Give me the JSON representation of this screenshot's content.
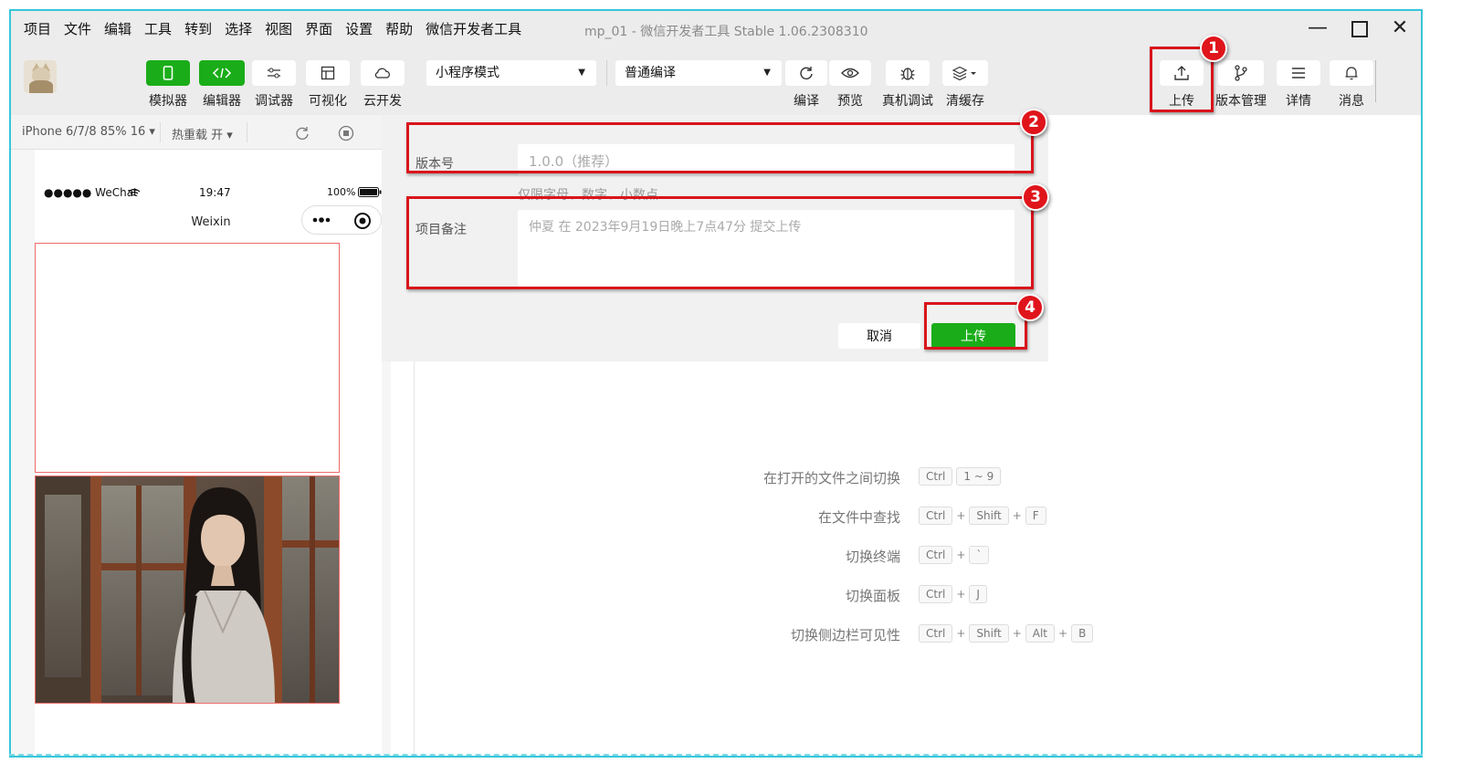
{
  "menu": [
    "项目",
    "文件",
    "编辑",
    "工具",
    "转到",
    "选择",
    "视图",
    "界面",
    "设置",
    "帮助",
    "微信开发者工具"
  ],
  "window": {
    "title": "mp_01 - 微信开发者工具 Stable 1.06.2308310"
  },
  "toolbar": {
    "simulator": "模拟器",
    "editor": "编辑器",
    "debugger": "调试器",
    "visual": "可视化",
    "cloud": "云开发",
    "mode_select": "小程序模式",
    "compile_select": "普通编译",
    "compile": "编译",
    "preview": "预览",
    "real_debug": "真机调试",
    "clear_cache": "清缓存",
    "upload": "上传",
    "version_mgmt": "版本管理",
    "details": "详情",
    "messages": "消息"
  },
  "simulator": {
    "device": "iPhone 6/7/8 85% 16 ▾",
    "hot_reload": "热重载 开 ▾",
    "carrier": "●●●●● WeChat",
    "time": "19:47",
    "battery": "100%",
    "nav_title": "Weixin"
  },
  "dialog": {
    "version_label": "版本号",
    "version_placeholder": "1.0.0（推荐）",
    "version_hint": "仅限字母、数字、小数点",
    "note_label": "项目备注",
    "note_placeholder": "仲夏  在  2023年9月19日晚上7点47分  提交上传",
    "cancel": "取消",
    "upload": "上传"
  },
  "annotations": [
    "1",
    "2",
    "3",
    "4"
  ],
  "shortcuts": [
    {
      "label": "在打开的文件之间切换",
      "keys": [
        "Ctrl",
        "1 ~ 9"
      ],
      "joined": false
    },
    {
      "label": "在文件中查找",
      "keys": [
        "Ctrl",
        "Shift",
        "F"
      ],
      "joined": true
    },
    {
      "label": "切换终端",
      "keys": [
        "Ctrl",
        "`"
      ],
      "joined": true
    },
    {
      "label": "切换面板",
      "keys": [
        "Ctrl",
        "J"
      ],
      "joined": true
    },
    {
      "label": "切换侧边栏可见性",
      "keys": [
        "Ctrl",
        "Shift",
        "Alt",
        "B"
      ],
      "joined": true
    }
  ],
  "colors": {
    "accent_green": "#1aad19",
    "annotation_red": "#d9141b",
    "frame_cyan": "#36c6d9"
  }
}
